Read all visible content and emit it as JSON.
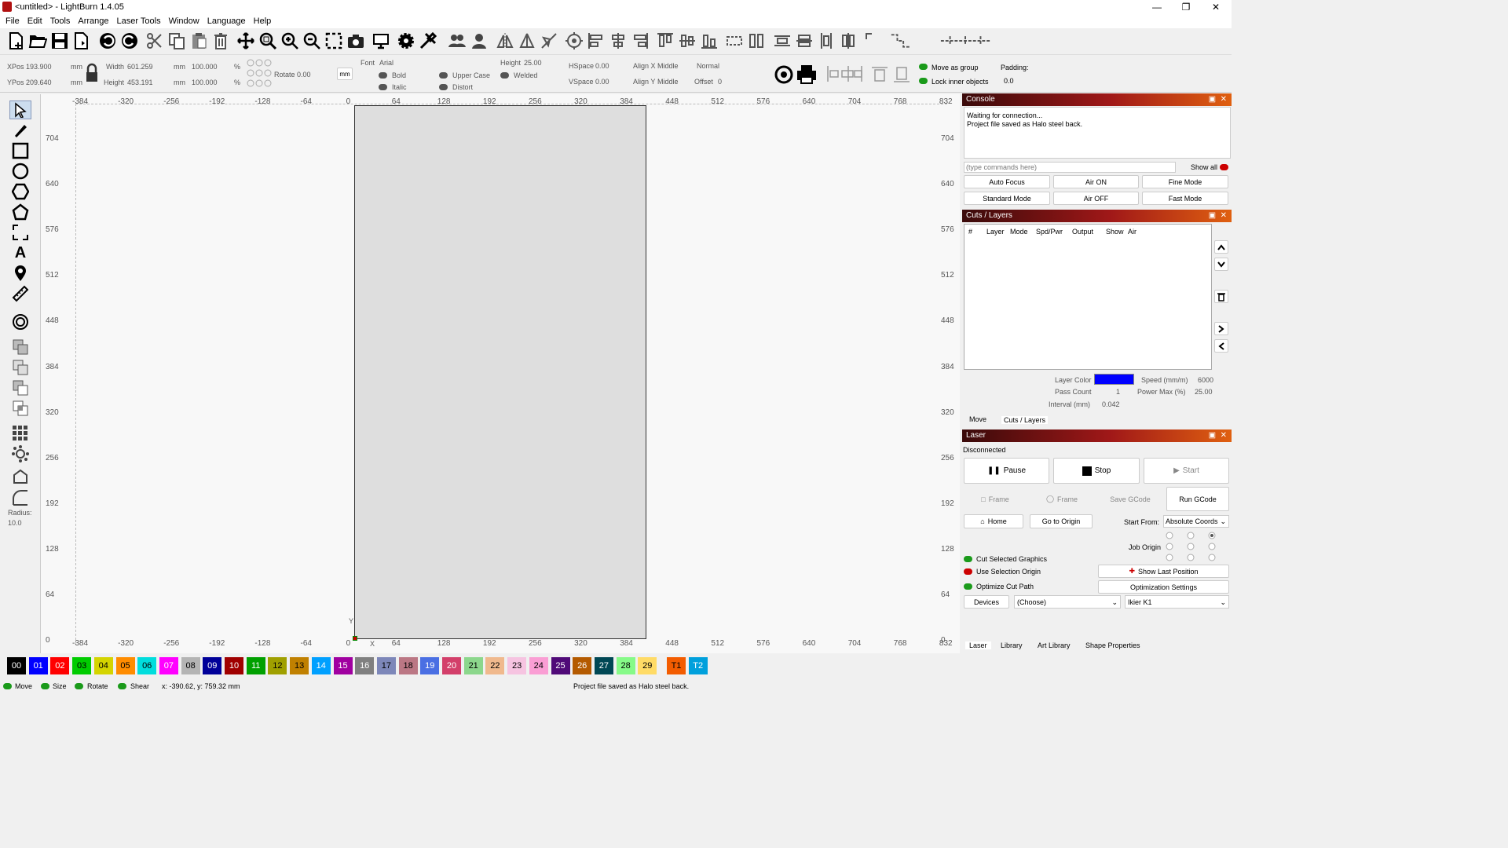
{
  "window": {
    "title": "<untitled> - LightBurn 1.4.05"
  },
  "menu": [
    "File",
    "Edit",
    "Tools",
    "Arrange",
    "Laser Tools",
    "Window",
    "Language",
    "Help"
  ],
  "pos": {
    "xpos_label": "XPos",
    "xpos": "193.900",
    "ypos_label": "YPos",
    "ypos": "209.640",
    "unit": "mm",
    "width_label": "Width",
    "width": "601.259",
    "height_label": "Height",
    "height": "453.191",
    "scale_w": "100.000",
    "scale_h": "100.000",
    "pct": "%",
    "rotate_label": "Rotate",
    "rotate": "0.00",
    "unit_btn": "mm"
  },
  "text": {
    "font_label": "Font",
    "font": "Arial",
    "height_label": "Height",
    "height": "25.00",
    "hspace_label": "HSpace",
    "hspace": "0.00",
    "vspace_label": "VSpace",
    "vspace": "0.00",
    "alignx_label": "Align X",
    "alignx": "Middle",
    "aligny_label": "Align Y",
    "aligny": "Middle",
    "mode": "Normal",
    "offset_label": "Offset",
    "offset": "0",
    "bold": "Bold",
    "italic": "Italic",
    "upper": "Upper Case",
    "distort": "Distort",
    "welded": "Welded"
  },
  "group": {
    "move_as_group": "Move as group",
    "lock_inner": "Lock inner objects",
    "padding_label": "Padding:",
    "padding": "0.0"
  },
  "left_tools": {
    "radius_label": "Radius:",
    "radius": "10.0"
  },
  "ruler": {
    "top": [
      "-384",
      "-320",
      "-256",
      "-192",
      "-128",
      "-64",
      "0",
      "64",
      "128",
      "192",
      "256",
      "320",
      "384",
      "448",
      "512",
      "576",
      "640",
      "704",
      "768",
      "832"
    ],
    "left": [
      "704",
      "640",
      "576",
      "512",
      "448",
      "384",
      "320",
      "256",
      "192",
      "128",
      "64",
      "0"
    ],
    "x_axis": "X",
    "y_axis": "Y"
  },
  "console": {
    "title": "Console",
    "lines": [
      "Waiting for connection...",
      "Project file saved as Halo steel back."
    ],
    "placeholder": "(type commands here)",
    "show_all": "Show all",
    "buttons": [
      "Auto Focus",
      "Air ON",
      "Fine Mode",
      "Standard Mode",
      "Air OFF",
      "Fast Mode"
    ]
  },
  "cuts": {
    "title": "Cuts / Layers",
    "columns": [
      "#",
      "Layer",
      "Mode",
      "Spd/Pwr",
      "Output",
      "Show",
      "Air"
    ],
    "layer_color_label": "Layer Color",
    "layer_color": "#0000ff",
    "speed_label": "Speed (mm/m)",
    "speed": "6000",
    "pass_label": "Pass Count",
    "pass": "1",
    "power_label": "Power Max (%)",
    "power": "25.00",
    "interval_label": "Interval (mm)",
    "interval": "0.042",
    "tabs": [
      "Move",
      "Cuts / Layers"
    ]
  },
  "laser": {
    "title": "Laser",
    "status": "Disconnected",
    "pause": "Pause",
    "stop": "Stop",
    "start": "Start",
    "frame1": "Frame",
    "frame2": "Frame",
    "save_gcode": "Save GCode",
    "run_gcode": "Run GCode",
    "home": "Home",
    "go_origin": "Go to Origin",
    "start_from_label": "Start From:",
    "start_from": "Absolute Coords",
    "job_origin": "Job Origin",
    "cut_selected": "Cut Selected Graphics",
    "use_sel_origin": "Use Selection Origin",
    "optimize": "Optimize Cut Path",
    "show_last": "Show Last Position",
    "opt_settings": "Optimization Settings",
    "devices": "Devices",
    "choose": "(Choose)",
    "device": "Ikier K1",
    "tabs": [
      "Laser",
      "Library",
      "Art Library",
      "Shape Properties"
    ]
  },
  "palette": [
    {
      "n": "00",
      "c": "#000000",
      "t": "#ffffff"
    },
    {
      "n": "01",
      "c": "#0000ff",
      "t": "#ffffff"
    },
    {
      "n": "02",
      "c": "#ff0000",
      "t": "#ffffff"
    },
    {
      "n": "03",
      "c": "#00cc00",
      "t": "#000000"
    },
    {
      "n": "04",
      "c": "#d4d400",
      "t": "#000000"
    },
    {
      "n": "05",
      "c": "#ff8c00",
      "t": "#000000"
    },
    {
      "n": "06",
      "c": "#00dddd",
      "t": "#000000"
    },
    {
      "n": "07",
      "c": "#ff00ff",
      "t": "#ffffff"
    },
    {
      "n": "08",
      "c": "#b4b4b4",
      "t": "#000000"
    },
    {
      "n": "09",
      "c": "#000099",
      "t": "#ffffff"
    },
    {
      "n": "10",
      "c": "#a00000",
      "t": "#ffffff"
    },
    {
      "n": "11",
      "c": "#00a000",
      "t": "#ffffff"
    },
    {
      "n": "12",
      "c": "#a0a000",
      "t": "#000000"
    },
    {
      "n": "13",
      "c": "#c08000",
      "t": "#000000"
    },
    {
      "n": "14",
      "c": "#00a0ff",
      "t": "#ffffff"
    },
    {
      "n": "15",
      "c": "#a000a0",
      "t": "#ffffff"
    },
    {
      "n": "16",
      "c": "#808080",
      "t": "#ffffff"
    },
    {
      "n": "17",
      "c": "#7d87b9",
      "t": "#000000"
    },
    {
      "n": "18",
      "c": "#bb7784",
      "t": "#000000"
    },
    {
      "n": "19",
      "c": "#4a6fe3",
      "t": "#ffffff"
    },
    {
      "n": "20",
      "c": "#d33f6a",
      "t": "#ffffff"
    },
    {
      "n": "21",
      "c": "#8cd78c",
      "t": "#000000"
    },
    {
      "n": "22",
      "c": "#f0b98d",
      "t": "#000000"
    },
    {
      "n": "23",
      "c": "#f6c4e1",
      "t": "#000000"
    },
    {
      "n": "24",
      "c": "#fa9ed4",
      "t": "#000000"
    },
    {
      "n": "25",
      "c": "#500a78",
      "t": "#ffffff"
    },
    {
      "n": "26",
      "c": "#b45a00",
      "t": "#ffffff"
    },
    {
      "n": "27",
      "c": "#004754",
      "t": "#ffffff"
    },
    {
      "n": "28",
      "c": "#86fa88",
      "t": "#000000"
    },
    {
      "n": "29",
      "c": "#ffdb66",
      "t": "#000000"
    },
    {
      "n": "T1",
      "c": "#f35c00",
      "t": "#000000"
    },
    {
      "n": "T2",
      "c": "#00a0dc",
      "t": "#ffffff"
    }
  ],
  "status": {
    "move": "Move",
    "size": "Size",
    "rotate": "Rotate",
    "shear": "Shear",
    "coords": "x: -390.62, y: 759.32 mm",
    "message": "Project file saved as Halo steel back."
  }
}
